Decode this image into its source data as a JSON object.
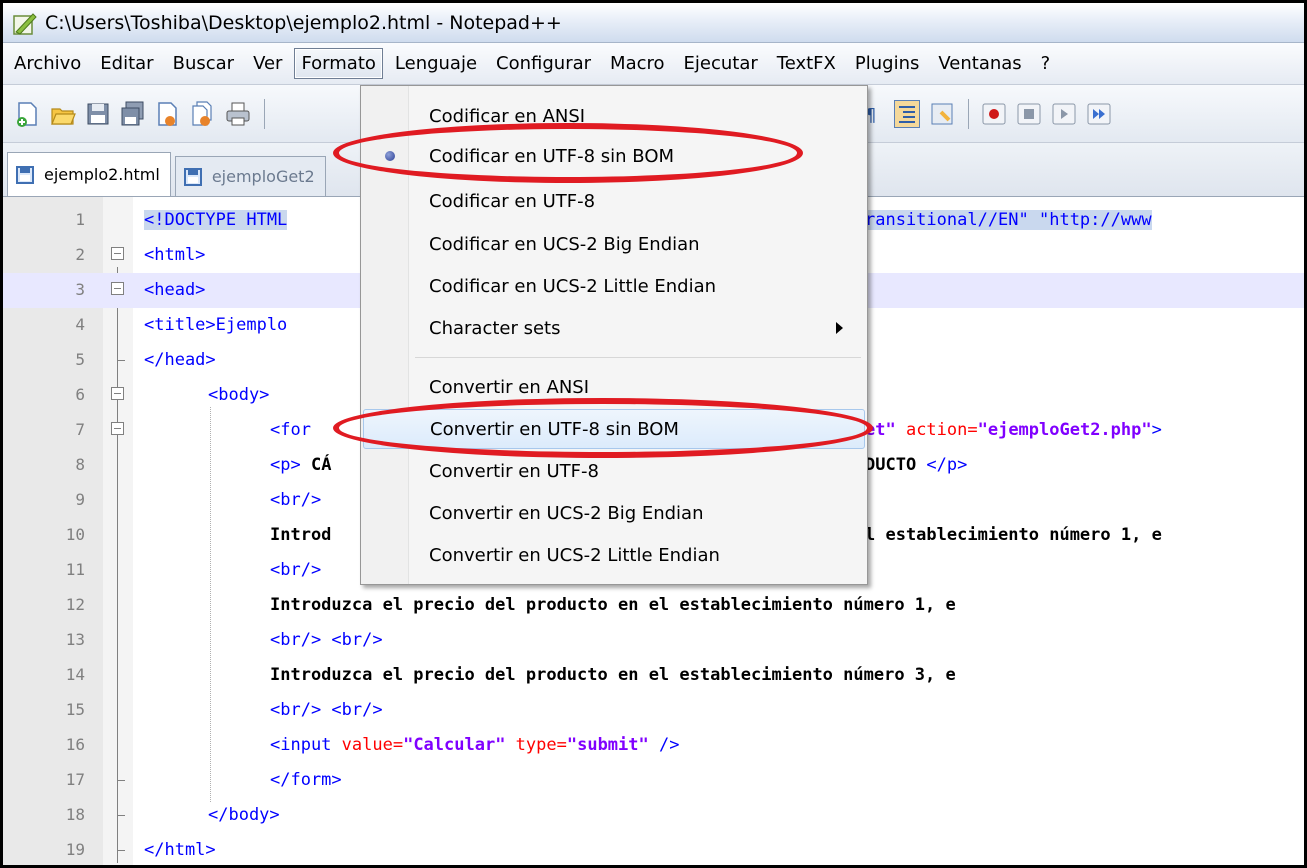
{
  "window": {
    "title": "C:\\Users\\Toshiba\\Desktop\\ejemplo2.html - Notepad++"
  },
  "menubar": {
    "items": [
      "Archivo",
      "Editar",
      "Buscar",
      "Ver",
      "Formato",
      "Lenguaje",
      "Configurar",
      "Macro",
      "Ejecutar",
      "TextFX",
      "Plugins",
      "Ventanas",
      "?"
    ],
    "active": "Formato"
  },
  "tabs": [
    {
      "label": "ejemplo2.html",
      "active": true
    },
    {
      "label": "ejemploGet2",
      "active": false
    }
  ],
  "format_menu": {
    "items": [
      {
        "label": "Codificar en ANSI",
        "checked": false
      },
      {
        "label": "Codificar en UTF-8 sin BOM",
        "checked": true,
        "highlighted_circle": true
      },
      {
        "label": "Codificar en UTF-8"
      },
      {
        "label": "Codificar en UCS-2 Big Endian"
      },
      {
        "label": "Codificar en UCS-2 Little Endian"
      },
      {
        "label": "Character sets",
        "submenu": true
      },
      {
        "label": "Convertir en ANSI"
      },
      {
        "label": "Convertir en UTF-8 sin BOM",
        "hover": true,
        "highlighted_circle": true
      },
      {
        "label": "Convertir en UTF-8"
      },
      {
        "label": "Convertir en UCS-2 Big Endian"
      },
      {
        "label": "Convertir en UCS-2 Little Endian"
      }
    ],
    "annotation_color": "#e01b22"
  },
  "editor": {
    "line_numbers": [
      "1",
      "2",
      "3",
      "4",
      "5",
      "6",
      "7",
      "8",
      "9",
      "10",
      "11",
      "12",
      "13",
      "14",
      "15",
      "16",
      "17",
      "18",
      "19"
    ],
    "current_line": 3,
    "visible_code": {
      "l1a": "<!DOCTYPE HTML",
      "l1b": "ransitional//EN\" \"http://www",
      "l2": "<html>",
      "l3": "<head>",
      "l4": "<title>Ejemplo",
      "l5": "</head>",
      "l6": "<body>",
      "l7a": "<for",
      "l7b": "et\"",
      "l7c": " action=",
      "l7d": "\"ejemploGet2.php\"",
      "l7e": ">",
      "l8a": "<p>",
      "l8b": " CÁ",
      "l8c": "DUCTO ",
      "l8d": "</p>",
      "l9": "<br/>",
      "l10a": "Introd",
      "l10b": "l establecimiento número 1, e",
      "l11": "<br/>",
      "l12": "Introduzca el precio del producto en el establecimiento número 1, e",
      "l13": "<br/> <br/>",
      "l14": "Introduzca el precio del producto en el establecimiento número 3, e",
      "l15": "<br/> <br/>",
      "l16a": "<input ",
      "l16b": "value=",
      "l16c": "\"Calcular\"",
      "l16d": " type=",
      "l16e": "\"submit\"",
      "l16f": " />",
      "l17": "</form>",
      "l18": "</body>",
      "l19": "</html>"
    }
  },
  "colors": {
    "tag": "#0000ff",
    "attribute": "#ff0000",
    "string": "#8000ff",
    "selection": "#c9d8ee",
    "current_line": "#e8e8ff"
  },
  "icons": [
    "notepadpp-app-icon",
    "new-file-icon",
    "open-file-icon",
    "save-icon",
    "save-all-icon",
    "close-icon",
    "close-all-icon",
    "print-icon",
    "wrap-icon",
    "pilcrow-icon",
    "indent-guide-icon",
    "macro-record-icon",
    "macro-stop-icon",
    "macro-play-icon",
    "macro-run-multiple-icon"
  ]
}
